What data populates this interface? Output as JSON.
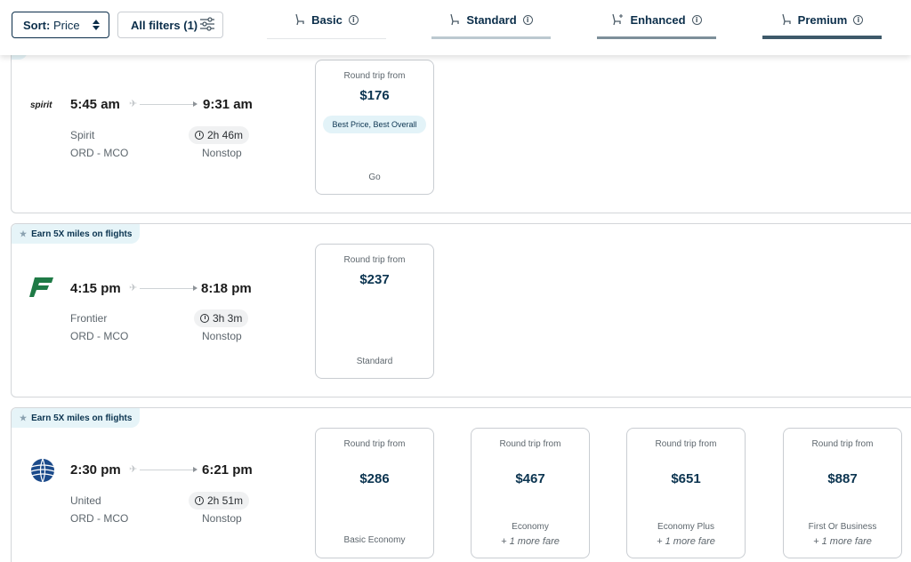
{
  "toolbar": {
    "sort_label": "Sort:",
    "sort_value": "Price",
    "filters_label": "All filters (1)"
  },
  "tabs": [
    {
      "label": "Basic",
      "bar_color": "#e3e6e8"
    },
    {
      "label": "Standard",
      "bar_color": "#bcc9d0"
    },
    {
      "label": "Enhanced",
      "bar_color": "#7d8f9a"
    },
    {
      "label": "Premium",
      "bar_color": "#3e5a6a"
    }
  ],
  "colors": {
    "brand_navy": "#0b3450",
    "badge_bg": "#e6f4f8",
    "frontier_green": "#1f7a46",
    "united_blue": "#1b4a8a"
  },
  "flights": [
    {
      "badge": "",
      "airline": "Spirit",
      "logo": "spirit",
      "dep": "5:45 am",
      "arr": "9:31 am",
      "route": "ORD - MCO",
      "duration": "2h 46m",
      "stops": "Nonstop",
      "fares": [
        {
          "from": "Round trip from",
          "price": "$176",
          "tag": "Best Price, Best Overall",
          "cls": "Go",
          "more": ""
        }
      ]
    },
    {
      "badge": "Earn 5X miles on flights",
      "airline": "Frontier",
      "logo": "frontier-logo",
      "dep": "4:15 pm",
      "arr": "8:18 pm",
      "route": "ORD - MCO",
      "duration": "3h 3m",
      "stops": "Nonstop",
      "fares": [
        {
          "from": "Round trip from",
          "price": "$237",
          "tag": "",
          "cls": "Standard",
          "more": ""
        }
      ]
    },
    {
      "badge": "Earn 5X miles on flights",
      "airline": "United",
      "logo": "united-globe-logo",
      "dep": "2:30 pm",
      "arr": "6:21 pm",
      "route": "ORD - MCO",
      "duration": "2h 51m",
      "stops": "Nonstop",
      "fares": [
        {
          "from": "Round trip from",
          "price": "$286",
          "tag": "",
          "cls": "Basic Economy",
          "more": ""
        },
        {
          "from": "Round trip from",
          "price": "$467",
          "tag": "",
          "cls": "Economy",
          "more": "+ 1 more fare"
        },
        {
          "from": "Round trip from",
          "price": "$651",
          "tag": "",
          "cls": "Economy Plus",
          "more": "+ 1 more fare"
        },
        {
          "from": "Round trip from",
          "price": "$887",
          "tag": "",
          "cls": "First Or Business",
          "more": "+ 1 more fare"
        }
      ]
    }
  ]
}
